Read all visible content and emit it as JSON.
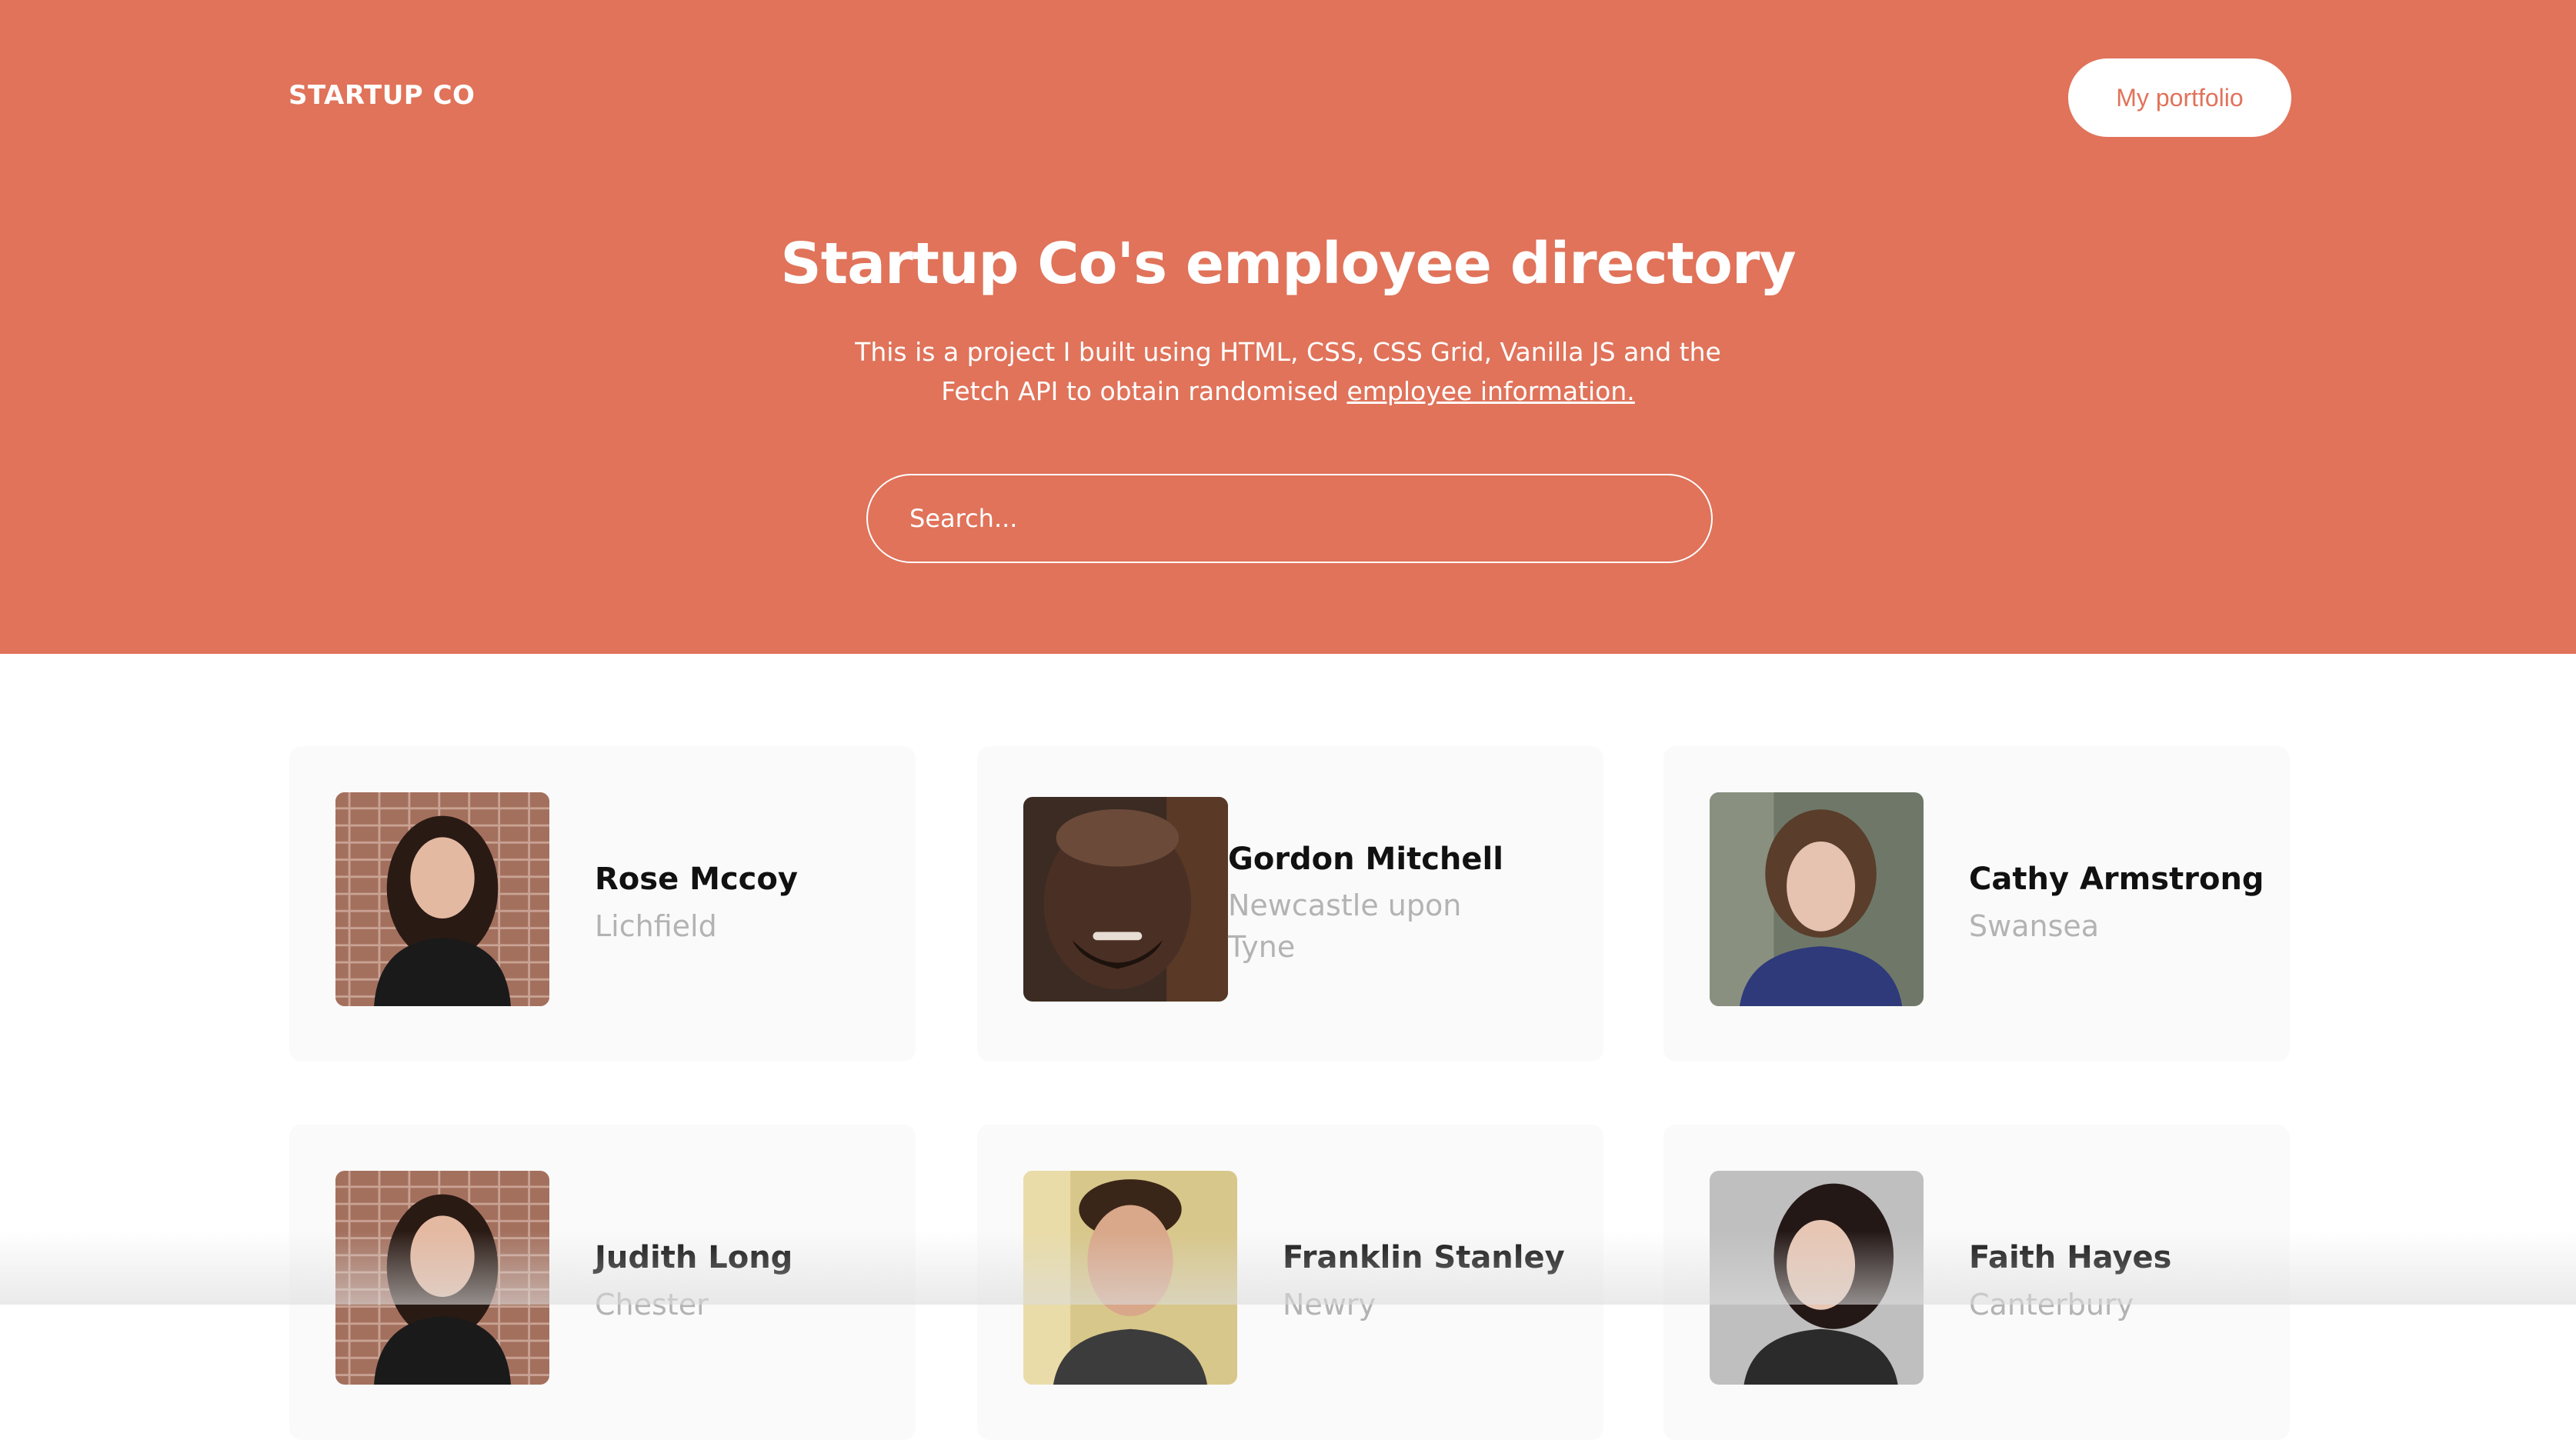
{
  "header": {
    "brand": "STARTUP CO",
    "portfolio_label": "My portfolio"
  },
  "hero": {
    "title": "Startup Co's employee directory",
    "description_text": "This is a project I built using HTML, CSS, CSS Grid, Vanilla JS and the Fetch API to obtain randomised ",
    "description_link": "employee information.",
    "search_placeholder": "Search..."
  },
  "colors": {
    "accent": "#e0735a",
    "card_bg": "#fafafa",
    "city_text": "#b3b3b3"
  },
  "employees": [
    {
      "name": "Rose Mccoy",
      "city": "Lichfield",
      "avatar_icon": "portrait-photo-icon"
    },
    {
      "name": "Gordon Mitchell",
      "city": "Newcastle upon Tyne",
      "avatar_icon": "portrait-photo-icon"
    },
    {
      "name": "Cathy Armstrong",
      "city": "Swansea",
      "avatar_icon": "portrait-photo-icon"
    },
    {
      "name": "Judith Long",
      "city": "Chester",
      "avatar_icon": "portrait-photo-icon"
    },
    {
      "name": "Franklin Stanley",
      "city": "Newry",
      "avatar_icon": "portrait-photo-icon"
    },
    {
      "name": "Faith Hayes",
      "city": "Canterbury",
      "avatar_icon": "portrait-photo-icon"
    }
  ]
}
